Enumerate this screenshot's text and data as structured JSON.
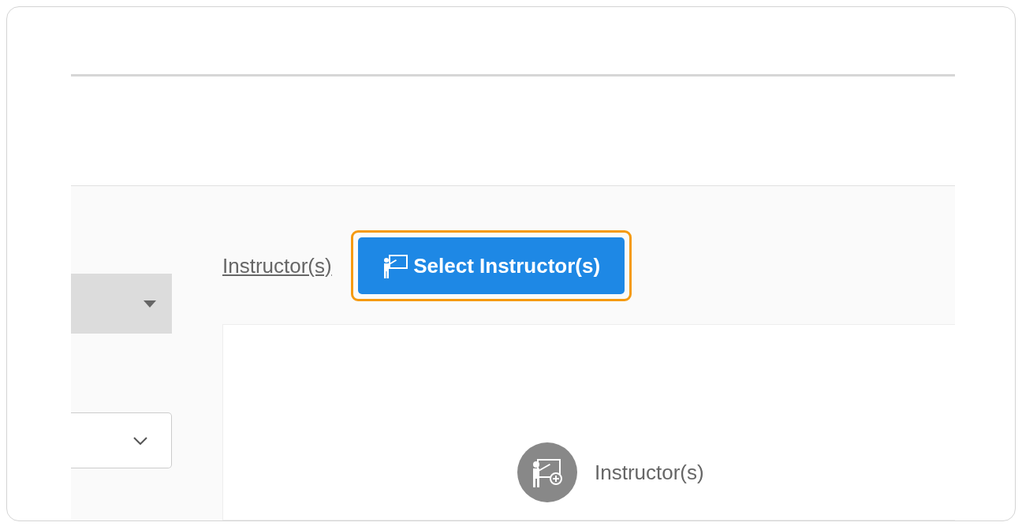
{
  "instructor_link": "Instructor(s)",
  "select_button": {
    "label": "Select Instructor(s)",
    "focused": true
  },
  "empty_state": {
    "label": "Instructor(s)"
  }
}
